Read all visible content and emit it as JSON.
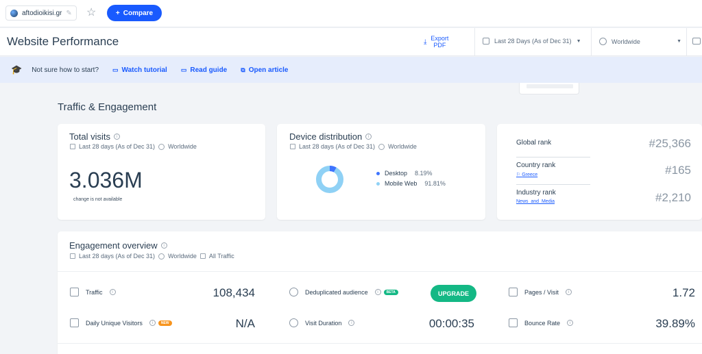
{
  "topbar": {
    "site": "aftodioikisi.gr",
    "compare_label": "Compare"
  },
  "header": {
    "title": "Website Performance",
    "export_line1": "Export",
    "export_line2": "PDF",
    "date_range": "Last 28 Days (As of Dec 31)",
    "region": "Worldwide"
  },
  "banner": {
    "question": "Not sure how to start?",
    "links": [
      "Watch tutorial",
      "Read guide",
      "Open article"
    ]
  },
  "section_title": "Traffic & Engagement",
  "total_visits": {
    "title": "Total visits",
    "period": "Last 28 days (As of Dec 31)",
    "region": "Worldwide",
    "value": "3.036M",
    "change_note": "change is not available"
  },
  "device_distribution": {
    "title": "Device distribution",
    "period": "Last 28 days (As of Dec 31)",
    "region": "Worldwide",
    "devices": [
      {
        "name": "Desktop",
        "share": "8.19%",
        "fraction": 0.0819,
        "color": "#3e74fe"
      },
      {
        "name": "Mobile Web",
        "share": "91.81%",
        "fraction": 0.9181,
        "color": "#8fd1f5"
      }
    ]
  },
  "ranks": [
    {
      "label": "Global rank",
      "sub": "",
      "value": "#25,366"
    },
    {
      "label": "Country rank",
      "sub": "Greece",
      "value": "#165"
    },
    {
      "label": "Industry rank",
      "sub": "News_and_Media",
      "value": "#2,210"
    }
  ],
  "engagement": {
    "title": "Engagement overview",
    "period": "Last 28 days (As of Dec 31)",
    "region": "Worldwide",
    "traffic_filter": "All Traffic",
    "traffic_label": "Traffic",
    "traffic_value": "108,434",
    "dedup_label": "Deduplicated audience",
    "dedup_badge": "BETA",
    "upgrade_label": "UPGRADE",
    "pages_label": "Pages / Visit",
    "pages_value": "1.72",
    "duv_label": "Daily Unique Visitors",
    "duv_badge": "NEW",
    "duv_value": "N/A",
    "duration_label": "Visit Duration",
    "duration_value": "00:00:35",
    "bounce_label": "Bounce Rate",
    "bounce_value": "39.89%"
  },
  "colors": {
    "accent": "#195afe",
    "upgrade": "#14b885",
    "new_badge": "#f7941d",
    "beta_badge": "#14b885"
  }
}
